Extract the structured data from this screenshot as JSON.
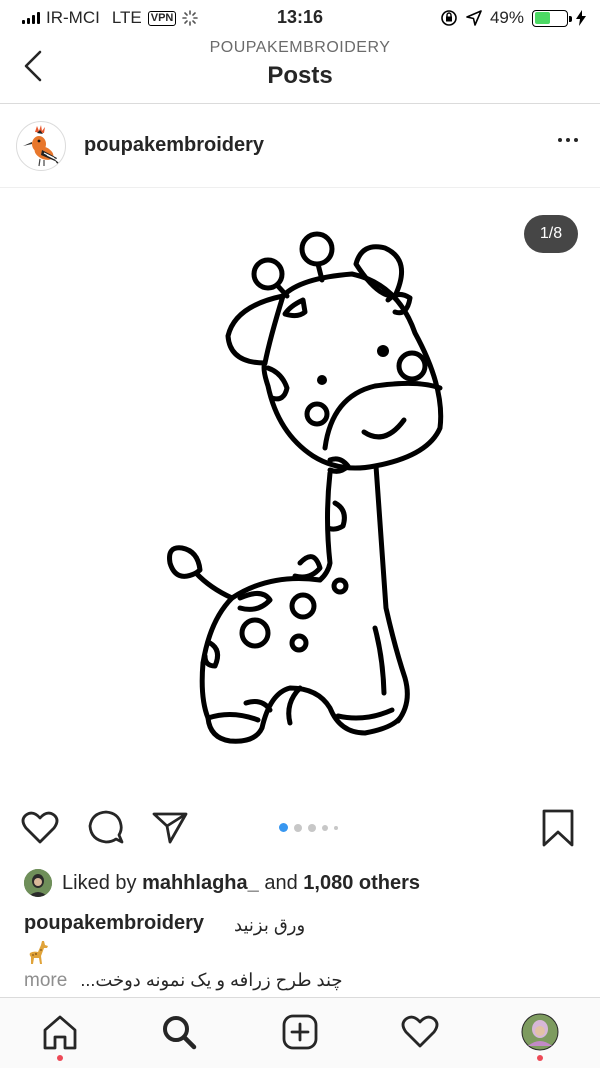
{
  "status_bar": {
    "carrier": "IR-MCI",
    "network": "LTE",
    "vpn": "VPN",
    "time": "13:16",
    "battery": "49%",
    "battery_level": 0.49
  },
  "nav": {
    "subtitle": "POUPAKEMBROIDERY",
    "title": "Posts",
    "back_icon": "chevron-left-icon"
  },
  "post": {
    "username": "poupakembroidery",
    "more_icon": "more-horizontal-icon",
    "carousel_counter": "1/8",
    "carousel_total": 8,
    "carousel_current": 1
  },
  "actions": {
    "like_icon": "heart-icon",
    "comment_icon": "comment-icon",
    "share_icon": "send-icon",
    "save_icon": "bookmark-icon"
  },
  "likes": {
    "prefix": "Liked by",
    "user": "mahhlagha_",
    "middle": "and",
    "others": "1,080 others"
  },
  "caption": {
    "username": "poupakembroidery",
    "text_line1": "ورق بزنید",
    "emoji": "giraffe-emoji",
    "more": "more",
    "text_line2": "چند طرح زرافه و یک نمونه دوخت..."
  },
  "tabbar": {
    "items": [
      "home-icon",
      "search-icon",
      "new-post-icon",
      "activity-icon",
      "profile-icon"
    ]
  },
  "colors": {
    "accent_blue": "#3897f0",
    "notification_red": "#ed4956",
    "battery_green": "#4cd964"
  }
}
